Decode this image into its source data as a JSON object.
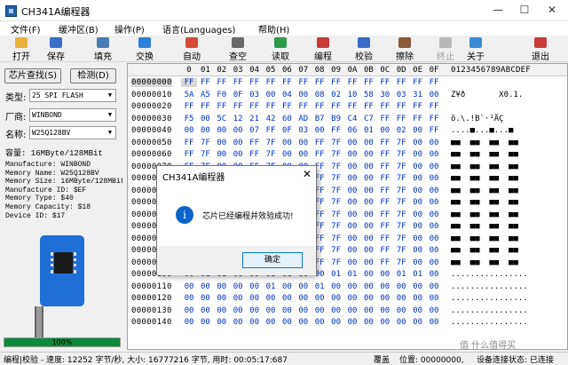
{
  "window": {
    "title": "CH341A编程器",
    "minimize": "—",
    "maximize": "☐",
    "close": "✕"
  },
  "menu": [
    "文件(F)",
    "缓冲区(B)",
    "操作(P)",
    "语言(Languages)",
    "帮助(H)"
  ],
  "toolbar": [
    {
      "label": "打开",
      "icon": "open-folder-icon",
      "color": "#e8b23a"
    },
    {
      "label": "保存",
      "icon": "save-disk-icon",
      "color": "#3a6fc8"
    },
    {
      "label": "填充",
      "icon": "fill-icon",
      "color": "#4a7ab8"
    },
    {
      "label": "交换",
      "icon": "swap-arrows-icon",
      "color": "#2d7fd8"
    },
    {
      "label": "自动",
      "icon": "auto-icon",
      "color": "#d84a3a"
    },
    {
      "label": "查空",
      "icon": "blank-check-icon",
      "color": "#6a6a6a"
    },
    {
      "label": "读取",
      "icon": "read-icon",
      "color": "#2a9a4a"
    },
    {
      "label": "编程",
      "icon": "program-icon",
      "color": "#c83a3a"
    },
    {
      "label": "校验",
      "icon": "verify-icon",
      "color": "#3a6ac8"
    },
    {
      "label": "擦除",
      "icon": "erase-icon",
      "color": "#8a5a3a"
    },
    {
      "label": "终止",
      "icon": "stop-icon",
      "color": "#b8b8b8",
      "disabled": true
    },
    {
      "label": "关于",
      "icon": "about-icon",
      "color": "#3a8ad8"
    },
    {
      "label": "退出",
      "icon": "exit-icon",
      "color": "#c83a3a"
    }
  ],
  "panel": {
    "detect_chip": "芯片查找(S)",
    "detect": "检测(D)",
    "type_label": "类型:",
    "type_value": "25 SPI FLASH",
    "vendor_label": "厂商:",
    "vendor_value": "WINBOND",
    "name_label": "名称:",
    "name_value": "W25Q128BV",
    "capacity": "容量: 16MByte/128MBit",
    "info": [
      "Manufacture: WINBOND",
      "Memory Name: W25Q128BV",
      "Memory Size: 16MByte/128MBit",
      "Manufacture ID: $EF",
      "Memory Type: $40",
      "Memory Capacity: $18",
      "Device ID: $17"
    ],
    "progress_percent": 100,
    "progress_text": "100%"
  },
  "hex": {
    "columns": [
      "0",
      "01",
      "02",
      "03",
      "04",
      "05",
      "06",
      "07",
      "08",
      "09",
      "0A",
      "0B",
      "0C",
      "0D",
      "0E",
      "0F"
    ],
    "ascii_header": "0123456789ABCDEF",
    "rows": [
      {
        "addr": "00000000",
        "bytes": "FF FF FF FF FF FF FF FF FF FF FF FF FF FF FF FF",
        "ascii": ""
      },
      {
        "addr": "00000010",
        "bytes": "5A A5 F0 0F 03 00 04 00 08 02 10 58 30 03 31 00",
        "ascii": "Z¥ð       X0.1."
      },
      {
        "addr": "00000020",
        "bytes": "FF FF FF FF FF FF FF FF FF FF FF FF FF FF FF FF",
        "ascii": ""
      },
      {
        "addr": "00000030",
        "bytes": "F5 00 5C 12 21 42 60 AD B7 B9 C4 C7 FF FF FF FF",
        "ascii": "õ.\\.!B`­·¹ÄÇ"
      },
      {
        "addr": "00000040",
        "bytes": "00 00 00 00 07 FF 0F 03 00 FF 06 01 00 02 00 FF",
        "ascii": "....■...■...■"
      },
      {
        "addr": "00000050",
        "bytes": "FF 7F 00 00 FF 7F 00 00 FF 7F 00 00 FF 7F 00 00",
        "ascii": "■■  ■■  ■■  ■■"
      },
      {
        "addr": "00000060",
        "bytes": "FF 7F 00 00 FF 7F 00 00 FF 7F 00 00 FF 7F 00 00",
        "ascii": "■■  ■■  ■■  ■■"
      },
      {
        "addr": "00000070",
        "bytes": "FF 7F 00 00 FF 7F 00 00 FF 7F 00 00 FF 7F 00 00",
        "ascii": "■■  ■■  ■■  ■■"
      },
      {
        "addr": "00000080",
        "bytes": "FF 7F 00 00 FF 7F 00 00 FF 7F 00 00 FF 7F 00 00",
        "ascii": "■■  ■■  ■■  ■■"
      },
      {
        "addr": "00000090",
        "bytes": "FF 7F 00 00 FF 7F 00 00 FF 7F 00 00 FF 7F 00 00",
        "ascii": "■■  ■■  ■■  ■■"
      },
      {
        "addr": "000000A0",
        "bytes": "FF 7F 00 00 FF 7F 00 00 FF 7F 00 00 FF 7F 00 00",
        "ascii": "■■  ■■  ■■  ■■"
      },
      {
        "addr": "000000B0",
        "bytes": "FF 7F 00 00 FF 7F 00 00 FF 7F 00 00 FF 7F 00 00",
        "ascii": "■■  ■■  ■■  ■■"
      },
      {
        "addr": "000000C0",
        "bytes": "FF 7F 00 00 FF 7F 00 00 FF 7F 00 00 FF 7F 00 00",
        "ascii": "■■  ■■  ■■  ■■"
      },
      {
        "addr": "000000D0",
        "bytes": "FF 7F 00 00 FF 7F 00 00 FF 7F 00 00 FF 7F 00 00",
        "ascii": "■■  ■■  ■■  ■■"
      },
      {
        "addr": "000000E0",
        "bytes": "FF 7F 00 00 FF 7F 00 00 FF 7F 00 00 FF 7F 00 00",
        "ascii": "■■  ■■  ■■  ■■"
      },
      {
        "addr": "000000F0",
        "bytes": "FF 7F 00 00 FF 7F 00 00 FF 7F 00 00 FF 7F 00 00",
        "ascii": "■■  ■■  ■■  ■■"
      },
      {
        "addr": "00000100",
        "bytes": "00 01 01 00 00 01 01 00 00 01 01 00 00 01 01 00",
        "ascii": "................"
      },
      {
        "addr": "00000110",
        "bytes": "00 00 00 00 00 01 00 00 01 00 00 00 00 00 00 00",
        "ascii": "................"
      },
      {
        "addr": "00000120",
        "bytes": "00 00 00 00 00 00 00 00 00 00 00 00 00 00 00 00",
        "ascii": "................"
      },
      {
        "addr": "00000130",
        "bytes": "00 00 00 00 00 00 00 00 00 00 00 00 00 00 00 00",
        "ascii": "................"
      },
      {
        "addr": "00000140",
        "bytes": "00 00 00 00 00 00 00 00 00 00 00 00 00 00 00 00",
        "ascii": "................"
      }
    ]
  },
  "status": {
    "op": "编程|校验 - 速度: 12252 字节/秒, 大小: 16777216 字节, 用时: 00:05:17:687",
    "mode": "覆盖",
    "position": "位置: 00000000,",
    "device": "设备连接状态: 已连接"
  },
  "dialog": {
    "title": "CH341A编程器",
    "close": "✕",
    "icon": "i",
    "message": "芯片已经编程并效验成功!",
    "ok": "确定"
  },
  "watermark": "值 什么值得买"
}
